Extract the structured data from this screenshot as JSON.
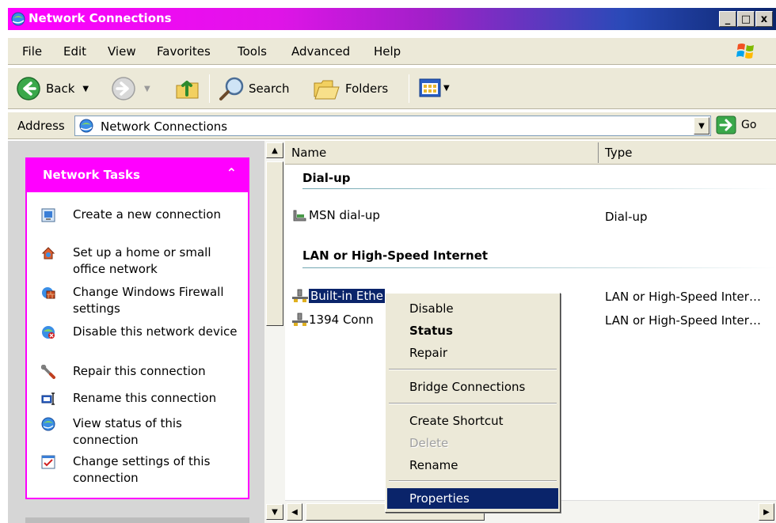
{
  "window": {
    "title": "Network Connections",
    "controls": [
      "_",
      "□",
      "x"
    ]
  },
  "menubar": {
    "items": [
      "File",
      "Edit",
      "View",
      "Favorites",
      "Tools",
      "Advanced",
      "Help"
    ]
  },
  "toolbar": {
    "back_label": "Back",
    "search_label": "Search",
    "folders_label": "Folders"
  },
  "address": {
    "label": "Address",
    "value": "Network Connections",
    "go_label": "Go"
  },
  "tasks": {
    "title": "Network Tasks",
    "items": [
      {
        "label": "Create a new connection",
        "icon": "new-connection-icon"
      },
      {
        "label": "Set up a home or small office network",
        "icon": "home-network-icon"
      },
      {
        "label": "Change Windows Firewall settings",
        "icon": "firewall-icon"
      },
      {
        "label": "Disable this network device",
        "icon": "disable-device-icon"
      },
      {
        "label": "Repair this connection",
        "icon": "repair-icon"
      },
      {
        "label": "Rename this connection",
        "icon": "rename-icon"
      },
      {
        "label": "View status of this connection",
        "icon": "status-icon"
      },
      {
        "label": "Change settings of this connection",
        "icon": "settings-icon"
      }
    ]
  },
  "list": {
    "columns": [
      "Name",
      "Type"
    ],
    "groups": [
      {
        "title": "Dial-up",
        "rows": [
          {
            "name": "MSN dial-up",
            "type": "Dial-up"
          }
        ]
      },
      {
        "title": "LAN or High-Speed Internet",
        "rows": [
          {
            "name": "Built-in Ethe",
            "type": "LAN or High-Speed Inter…"
          },
          {
            "name": "1394 Conn",
            "type": "LAN or High-Speed Inter…"
          }
        ]
      }
    ]
  },
  "context_menu": {
    "items": [
      {
        "label": "Disable",
        "style": "normal"
      },
      {
        "label": "Status",
        "style": "bold"
      },
      {
        "label": "Repair",
        "style": "normal"
      },
      {
        "label": "Bridge Connections",
        "style": "normal"
      },
      {
        "label": "Create Shortcut",
        "style": "normal"
      },
      {
        "label": "Delete",
        "style": "disabled"
      },
      {
        "label": "Rename",
        "style": "normal"
      },
      {
        "label": "Properties",
        "style": "highlighted"
      }
    ]
  },
  "colors": {
    "title_gradient_start": "#ff00ff",
    "title_gradient_end": "#0a246a",
    "task_header": "#ff00ff",
    "selection": "#0a246a",
    "menu_bg": "#ece9d8"
  }
}
